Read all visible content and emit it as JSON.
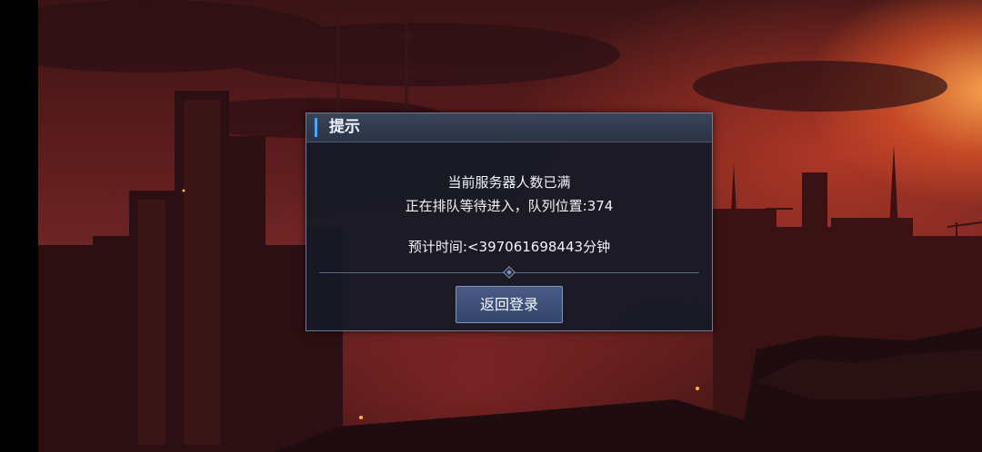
{
  "dialog": {
    "title": "提示",
    "line1": "当前服务器人数已满",
    "line2": "正在排队等待进入，队列位置:374",
    "line3": "预计时间:<397061698443分钟",
    "button_label": "返回登录"
  },
  "colors": {
    "accent": "#4aa6ff",
    "button": "#3d4f78",
    "dialog_bg": "#141a26"
  }
}
